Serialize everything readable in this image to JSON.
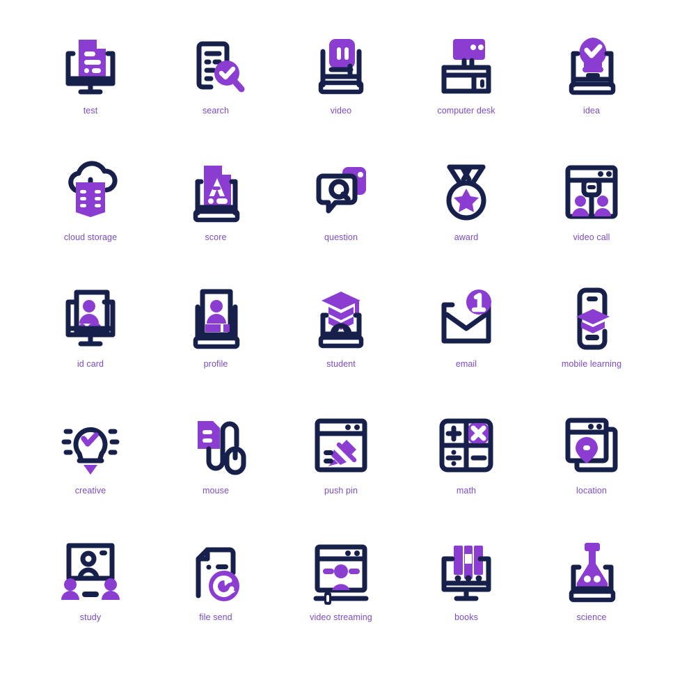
{
  "palette": {
    "purple": "#8B3DD1",
    "navy": "#16204A",
    "label": "#7B4BC4",
    "background": "#FFFFFF"
  },
  "grid": {
    "columns": 5,
    "rows": 5,
    "total_icons": 25
  },
  "icons": [
    {
      "id": "test",
      "label": "test",
      "icon_name": "document-on-monitor-icon"
    },
    {
      "id": "search",
      "label": "search",
      "icon_name": "document-magnifier-check-icon"
    },
    {
      "id": "video",
      "label": "video",
      "icon_name": "video-pause-board-icon"
    },
    {
      "id": "computer_desk",
      "label": "computer desk",
      "icon_name": "computer-desk-icon"
    },
    {
      "id": "idea",
      "label": "idea",
      "icon_name": "lightbulb-check-board-icon"
    },
    {
      "id": "cloud_storage",
      "label": "cloud storage",
      "icon_name": "cloud-book-icon"
    },
    {
      "id": "score",
      "label": "score",
      "icon_name": "grade-a-document-board-icon"
    },
    {
      "id": "question",
      "label": "question",
      "icon_name": "question-chat-bubble-icon"
    },
    {
      "id": "award",
      "label": "award",
      "icon_name": "medal-star-icon"
    },
    {
      "id": "video_call",
      "label": "video call",
      "icon_name": "video-call-window-icon"
    },
    {
      "id": "id_card",
      "label": "id card",
      "icon_name": "id-card-monitor-icon"
    },
    {
      "id": "profile",
      "label": "profile",
      "icon_name": "profile-board-icon"
    },
    {
      "id": "student",
      "label": "student",
      "icon_name": "graduation-cap-laptop-icon"
    },
    {
      "id": "email",
      "label": "email",
      "icon_name": "email-envelope-badge-icon"
    },
    {
      "id": "mobile_learning",
      "label": "mobile learning",
      "icon_name": "mobile-graduation-icon"
    },
    {
      "id": "creative",
      "label": "creative",
      "icon_name": "lightbulb-check-rays-icon"
    },
    {
      "id": "mouse",
      "label": "mouse",
      "icon_name": "computer-mouse-document-icon"
    },
    {
      "id": "push_pin",
      "label": "push pin",
      "icon_name": "push-pin-window-icon"
    },
    {
      "id": "math",
      "label": "math",
      "icon_name": "calculator-operators-icon"
    },
    {
      "id": "location",
      "label": "location",
      "icon_name": "location-pin-window-icon"
    },
    {
      "id": "study",
      "label": "study",
      "icon_name": "whiteboard-students-icon"
    },
    {
      "id": "file_send",
      "label": "file send",
      "icon_name": "file-send-arrow-icon"
    },
    {
      "id": "video_streaming",
      "label": "video streaming",
      "icon_name": "video-streaming-player-icon"
    },
    {
      "id": "books",
      "label": "books",
      "icon_name": "books-on-monitor-icon"
    },
    {
      "id": "science",
      "label": "science",
      "icon_name": "science-flask-laptop-icon"
    }
  ]
}
